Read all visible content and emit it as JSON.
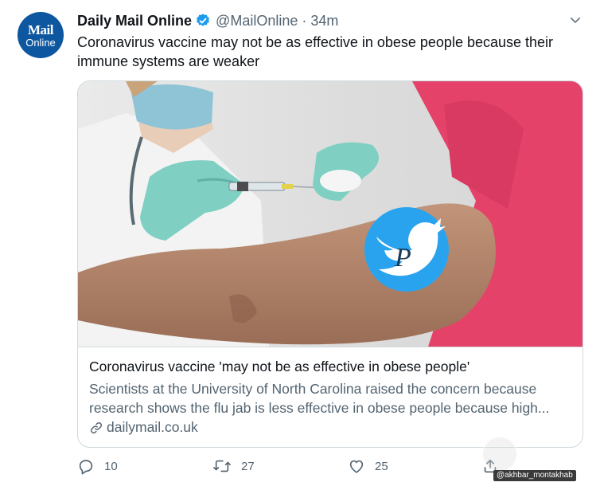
{
  "account": {
    "avatar_line1": "Mail",
    "avatar_line2": "Online",
    "name": "Daily Mail Online",
    "handle": "@MailOnline",
    "separator": "·",
    "time": "34m"
  },
  "tweet": {
    "text": "Coronavirus vaccine may not be as effective in obese people because their immune systems are weaker"
  },
  "card": {
    "title": "Coronavirus vaccine 'may not be as effective in obese people'",
    "description_line1": "Scientists at the University of North Carolina raised the concern because",
    "description_line2": "research shows the flu jab is less effective in obese people because high...",
    "domain": "dailymail.co.uk"
  },
  "actions": {
    "reply_count": "10",
    "retweet_count": "27",
    "like_count": "25"
  },
  "watermark": {
    "tag": "@akhbar_montakhab"
  },
  "colors": {
    "avatar_bg": "#0d57a0",
    "verified": "#1d9bf0",
    "secondary_text": "#536471",
    "border": "#cfd9de"
  },
  "icons": [
    "verified-badge-icon",
    "chevron-down-icon",
    "link-icon",
    "reply-icon",
    "retweet-icon",
    "like-icon",
    "share-icon",
    "twitter-bird-overlay-icon"
  ]
}
